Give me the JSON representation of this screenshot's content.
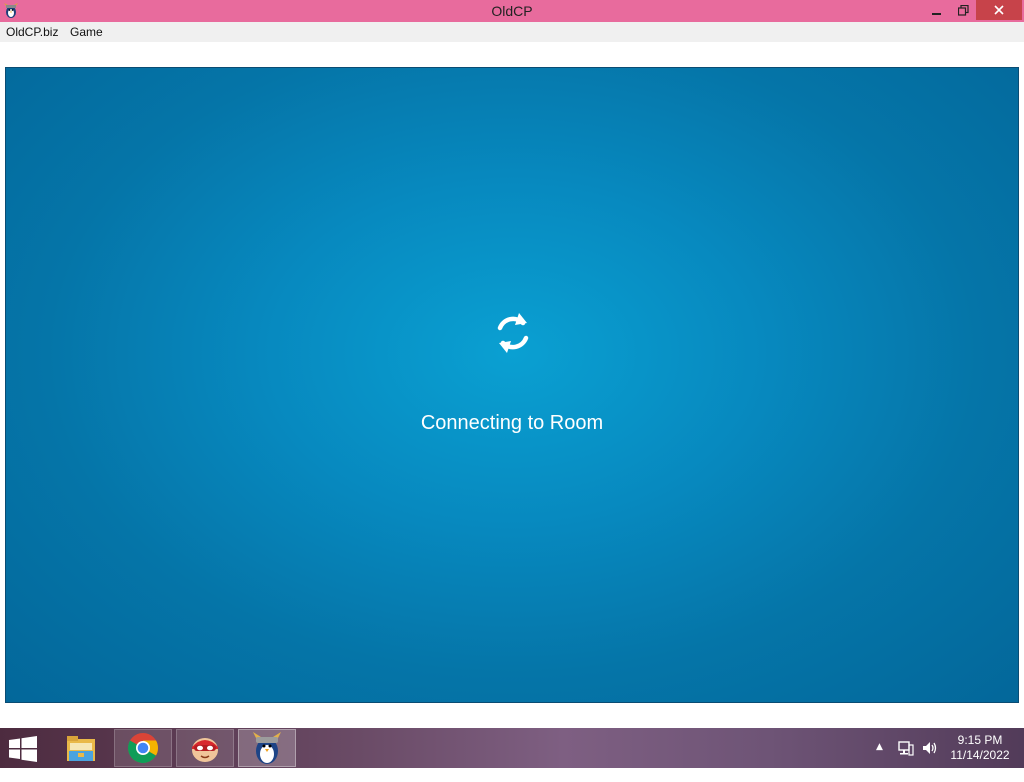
{
  "window": {
    "title": "OldCP",
    "titlebar_color": "#e86b9d"
  },
  "menu": {
    "items": [
      "OldCP.biz",
      "Game"
    ]
  },
  "game": {
    "status_icon": "refresh-icon",
    "status_text": "Connecting to Room",
    "bg_color": "#0789bf"
  },
  "taskbar": {
    "apps": [
      {
        "name": "File Explorer",
        "icon": "folder-icon"
      },
      {
        "name": "Google Chrome",
        "icon": "chrome-icon"
      },
      {
        "name": "Flash Player",
        "icon": "flash-mascot-icon"
      },
      {
        "name": "OldCP",
        "icon": "penguin-viking-icon"
      }
    ],
    "clock": {
      "time": "9:15 PM",
      "date": "11/14/2022"
    }
  }
}
